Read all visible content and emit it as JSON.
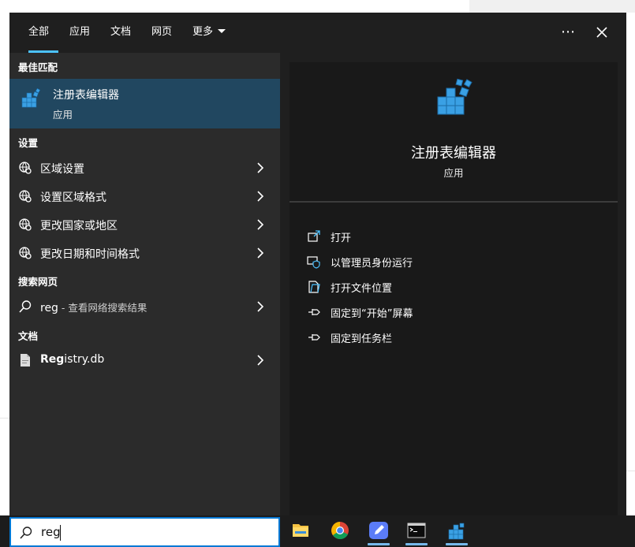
{
  "header": {
    "tabs": [
      {
        "label": "全部",
        "active": true
      },
      {
        "label": "应用"
      },
      {
        "label": "文档"
      },
      {
        "label": "网页"
      },
      {
        "label": "更多"
      }
    ],
    "more_icon": "ellipsis-icon",
    "close_icon": "close-icon"
  },
  "left": {
    "best_match_title": "最佳匹配",
    "best_match": {
      "name": "注册表编辑器",
      "type": "应用",
      "icon": "registry-editor-icon"
    },
    "settings_title": "设置",
    "settings": [
      {
        "label": "区域设置",
        "icon": "globe-settings-icon"
      },
      {
        "label": "设置区域格式",
        "icon": "globe-settings-icon"
      },
      {
        "label": "更改国家或地区",
        "icon": "globe-settings-icon"
      },
      {
        "label": "更改日期和时间格式",
        "icon": "globe-settings-icon"
      }
    ],
    "web_title": "搜索网页",
    "web": {
      "query": "reg",
      "suffix": " - 查看网络搜索结果",
      "icon": "search-icon"
    },
    "docs_title": "文档",
    "docs": [
      {
        "bold": "Reg",
        "rest": "istry.db",
        "icon": "file-icon"
      }
    ]
  },
  "right": {
    "app_name": "注册表编辑器",
    "app_type": "应用",
    "actions": [
      {
        "label": "打开",
        "icon": "open-icon"
      },
      {
        "label": "以管理员身份运行",
        "icon": "shield-icon"
      },
      {
        "label": "打开文件位置",
        "icon": "folder-open-icon"
      },
      {
        "label": "固定到“开始”屏幕",
        "icon": "pin-icon"
      },
      {
        "label": "固定到任务栏",
        "icon": "pin-icon"
      }
    ]
  },
  "taskbar": {
    "search_value": "reg",
    "apps": [
      "file-explorer-icon",
      "chrome-icon",
      "notes-app-icon",
      "terminal-icon",
      "registry-editor-icon"
    ]
  },
  "colors": {
    "accent": "#4cc2ff",
    "selected": "#214760",
    "searchbox_border": "#0078d4"
  }
}
